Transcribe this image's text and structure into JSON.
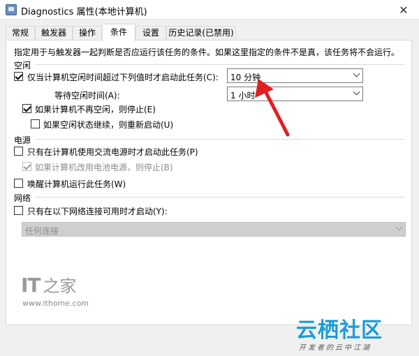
{
  "window": {
    "title": "Diagnostics 属性(本地计算机)",
    "close_glyph": "✕"
  },
  "tabs": [
    {
      "label": "常规"
    },
    {
      "label": "触发器"
    },
    {
      "label": "操作"
    },
    {
      "label": "条件"
    },
    {
      "label": "设置"
    },
    {
      "label": "历史记录(已禁用)"
    }
  ],
  "description": "指定用于与触发器一起判断是否应运行该任务的条件。如果这里指定的条件不是真，该任务将不会运行。",
  "idle": {
    "section_label": "空闲",
    "start_only_if_idle": {
      "label": "仅当计算机空闲时间超过下列值时才启动此任务(C):",
      "checked": true
    },
    "idle_duration": "10 分钟",
    "wait_label": "等待空闲时间(A):",
    "wait_value": "1 小时",
    "stop_if_not_idle": {
      "label": "如果计算机不再空闲，则停止(E)",
      "checked": true
    },
    "restart_if_idle": {
      "label": "如果空闲状态继续，则重新启动(U)",
      "checked": false
    }
  },
  "power": {
    "section_label": "电源",
    "ac_only": {
      "label": "只有在计算机使用交流电源时才启动此任务(P)",
      "checked": false
    },
    "stop_on_battery": {
      "label": "如果计算机改用电池电源，则停止(B)",
      "checked": true,
      "disabled": true
    },
    "wake": {
      "label": "唤醒计算机运行此任务(W)",
      "checked": false
    }
  },
  "network": {
    "section_label": "网络",
    "only_if_network": {
      "label": "只有在以下网络连接可用时才启动(Y):",
      "checked": false
    },
    "connection_value": "任何连接"
  },
  "watermarks": {
    "ithome_logo_text": "IT",
    "ithome_logo_char": "之家",
    "ithome_url": "www.ithome.com",
    "yunqi_main": "云栖社区",
    "yunqi_sub": "开发者的云中江湖"
  },
  "colors": {
    "annotation_arrow": "#e02020",
    "yunqi_blue": "#1f9ad6"
  }
}
